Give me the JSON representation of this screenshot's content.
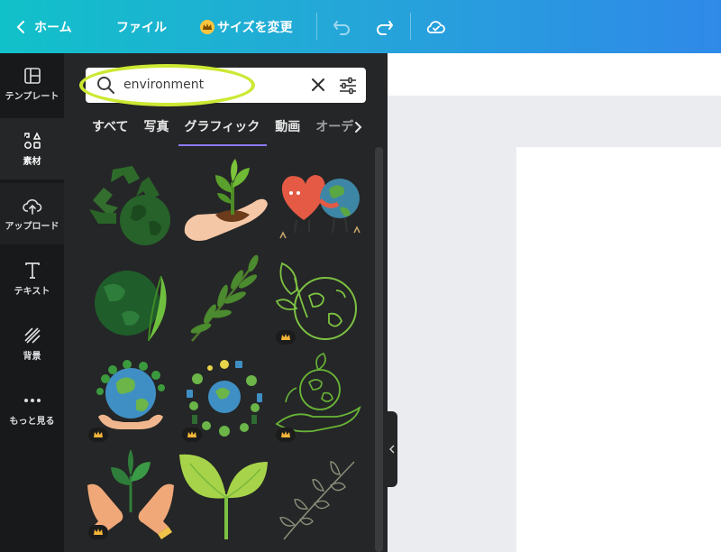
{
  "topbar": {
    "home_label": "ホーム",
    "file_label": "ファイル",
    "resize_label": "サイズを変更",
    "undo_icon": "undo-icon",
    "redo_icon": "redo-icon",
    "cloud_icon": "cloud-saved-icon"
  },
  "rail": {
    "items": [
      {
        "label": "テンプレート",
        "icon": "template-icon"
      },
      {
        "label": "素材",
        "icon": "elements-icon"
      },
      {
        "label": "アップロード",
        "icon": "upload-icon"
      },
      {
        "label": "テキスト",
        "icon": "text-icon"
      },
      {
        "label": "背景",
        "icon": "background-icon"
      },
      {
        "label": "もっと見る",
        "icon": "more-icon"
      }
    ]
  },
  "search": {
    "value": "environment",
    "placeholder": ""
  },
  "tabs": [
    "すべて",
    "写真",
    "グラフィック",
    "動画",
    "オーデ"
  ],
  "active_tab": "グラフィック",
  "graphics": [
    {
      "name": "recycle-globe-graphic",
      "premium": false
    },
    {
      "name": "hand-holding-sprout-graphic",
      "premium": false
    },
    {
      "name": "heart-hugging-earth-graphic",
      "premium": false
    },
    {
      "name": "leaf-globe-graphic",
      "premium": false
    },
    {
      "name": "leafy-branch-graphic",
      "premium": false
    },
    {
      "name": "line-earth-leaves-graphic",
      "premium": true
    },
    {
      "name": "hands-holding-earth-graphic",
      "premium": true
    },
    {
      "name": "eco-icons-globe-graphic",
      "premium": true
    },
    {
      "name": "hand-line-earth-graphic",
      "premium": true
    },
    {
      "name": "hands-with-plant-graphic",
      "premium": true
    },
    {
      "name": "two-leaf-sprout-graphic",
      "premium": false
    },
    {
      "name": "line-branch-graphic",
      "premium": false
    }
  ],
  "colors": {
    "topbar_start": "#11c1c9",
    "topbar_end": "#2f89e8",
    "panel_bg": "#252627",
    "rail_bg": "#18191b",
    "active_tab_underline": "#8b7cf7",
    "highlight": "#cde832"
  }
}
